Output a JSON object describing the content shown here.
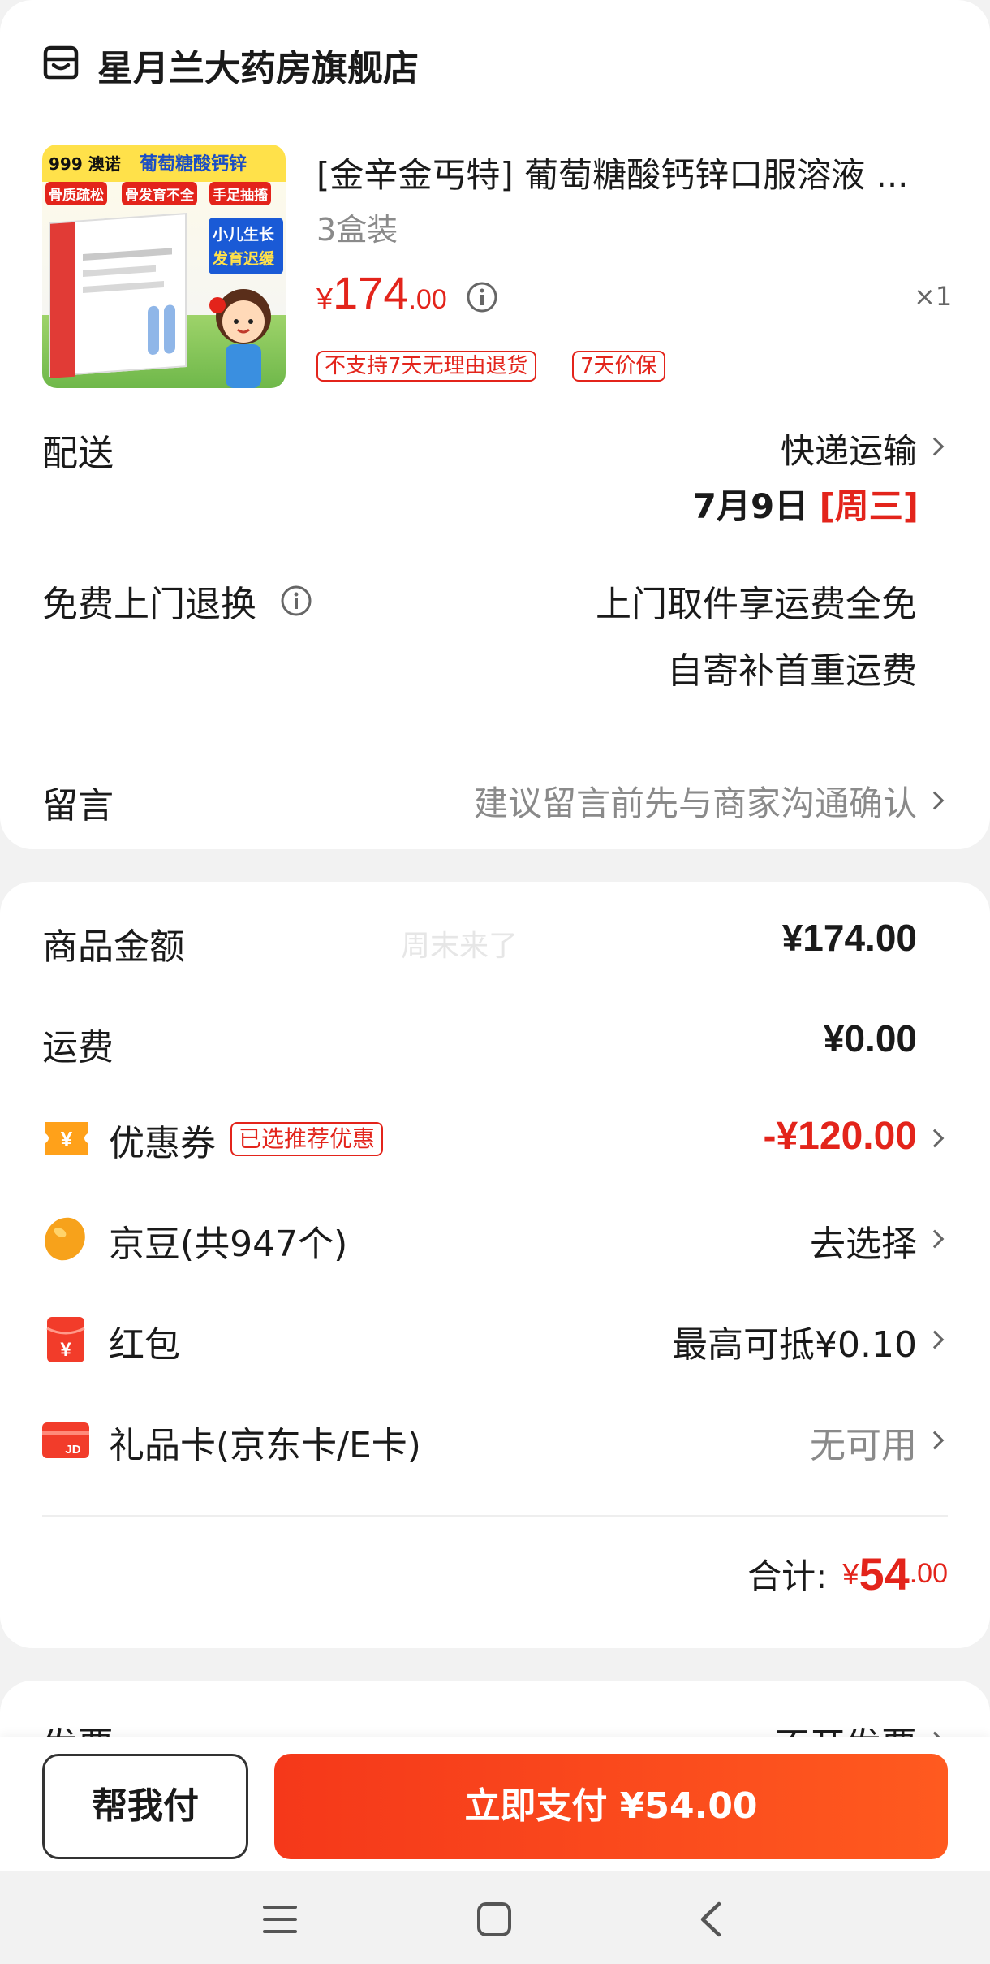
{
  "store": {
    "name": "星月兰大药房旗舰店"
  },
  "product": {
    "title": "[金辛金丐特] 葡萄糖酸钙锌口服溶液 ...",
    "spec": "3盒装",
    "currency": "¥",
    "price_int": "174",
    "price_dec": ".00",
    "qty": "×1",
    "tags": [
      "不支持7天无理由退货",
      "7天价保"
    ],
    "image": {
      "brand": "999 澳诺",
      "headline": "葡萄糖酸钙锌",
      "badges": [
        "骨质疏松",
        "骨发育不全",
        "手足抽搐"
      ],
      "side_text": [
        "小儿生长",
        "发育迟缓"
      ]
    }
  },
  "delivery": {
    "label": "配送",
    "method": "快递运输",
    "date": "7月9日",
    "weekday": "[周三]"
  },
  "return_service": {
    "label": "免费上门退换",
    "line1": "上门取件享运费全免",
    "line2": "自寄补首重运费"
  },
  "message": {
    "label": "留言",
    "placeholder": "建议留言前先与商家沟通确认"
  },
  "summary": {
    "goods_label": "商品金额",
    "goods_value": "¥174.00",
    "watermark": "周末来了",
    "shipping_label": "运费",
    "shipping_value": "¥0.00",
    "coupon_label": "优惠券",
    "coupon_tag": "已选推荐优惠",
    "coupon_value": "-¥120.00",
    "beans_label": "京豆(共947个)",
    "beans_value": "去选择",
    "redpacket_label": "红包",
    "redpacket_value": "最高可抵¥0.10",
    "giftcard_label": "礼品卡(京东卡/E卡)",
    "giftcard_value": "无可用",
    "total_label": "合计:",
    "total_currency": "¥",
    "total_int": "54",
    "total_dec": ".00"
  },
  "invoice": {
    "label": "发票",
    "value": "不开发票"
  },
  "bottom_bar": {
    "help_pay": "帮我付",
    "pay_now": "立即支付 ¥54.00"
  },
  "colors": {
    "accent": "#e3241b",
    "pay_gradient_start": "#f43a1a",
    "pay_gradient_end": "#ff5a1f"
  }
}
